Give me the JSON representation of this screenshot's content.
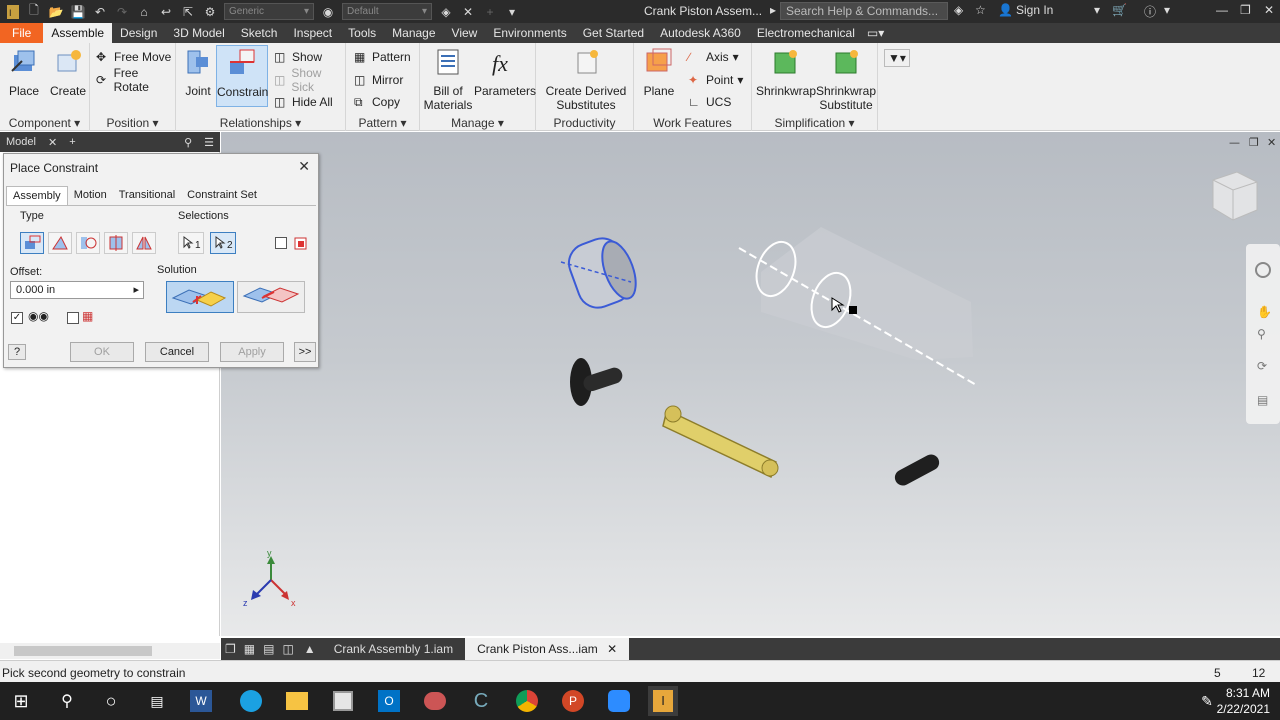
{
  "titlebar": {
    "combo1": "Generic",
    "combo2": "Default",
    "document_title": "Crank Piston Assem...",
    "search_placeholder": "Search Help & Commands...",
    "sign_in": "Sign In"
  },
  "tabs": [
    "File",
    "Assemble",
    "Design",
    "3D Model",
    "Sketch",
    "Inspect",
    "Tools",
    "Manage",
    "View",
    "Environments",
    "Get Started",
    "Autodesk A360",
    "Electromechanical"
  ],
  "active_tab": "Assemble",
  "ribbon": {
    "component": {
      "label": "Component",
      "place": "Place",
      "create": "Create"
    },
    "position": {
      "label": "Position",
      "free_move": "Free Move",
      "free_rotate": "Free Rotate"
    },
    "relationships": {
      "label": "Relationships",
      "joint": "Joint",
      "constrain": "Constrain",
      "show": "Show",
      "show_sick": "Show Sick",
      "hide_all": "Hide All"
    },
    "pattern": {
      "label": "Pattern",
      "pattern": "Pattern",
      "mirror": "Mirror",
      "copy": "Copy"
    },
    "manage": {
      "label": "Manage",
      "bom_line1": "Bill of",
      "bom_line2": "Materials",
      "parameters": "Parameters"
    },
    "productivity": {
      "label": "Productivity",
      "line1": "Create Derived",
      "line2": "Substitutes"
    },
    "work_features": {
      "label": "Work Features",
      "plane": "Plane",
      "axis": "Axis",
      "point": "Point",
      "ucs": "UCS"
    },
    "simplification": {
      "label": "Simplification",
      "shrinkwrap": "Shrinkwrap",
      "sw_sub_line1": "Shrinkwrap",
      "sw_sub_line2": "Substitute"
    }
  },
  "browser": {
    "tab": "Model"
  },
  "dialog": {
    "title": "Place Constraint",
    "tabs": [
      "Assembly",
      "Motion",
      "Transitional",
      "Constraint Set"
    ],
    "type_label": "Type",
    "selections_label": "Selections",
    "sel1": "1",
    "sel2": "2",
    "offset_label": "Offset:",
    "offset_value": "0.000 in",
    "solution_label": "Solution",
    "ok": "OK",
    "cancel": "Cancel",
    "apply": "Apply",
    "more": ">>"
  },
  "doc_tabs": [
    "Crank Assembly 1.iam",
    "Crank Piston Ass...iam"
  ],
  "status": {
    "message": "Pick second geometry to constrain",
    "count1": "5",
    "count2": "12"
  },
  "taskbar": {
    "time": "8:31 AM",
    "date": "2/22/2021"
  },
  "colors": {
    "file_tab": "#f26522",
    "accent_blue": "#3d7fc1",
    "title_bg": "#2b2b2b"
  }
}
